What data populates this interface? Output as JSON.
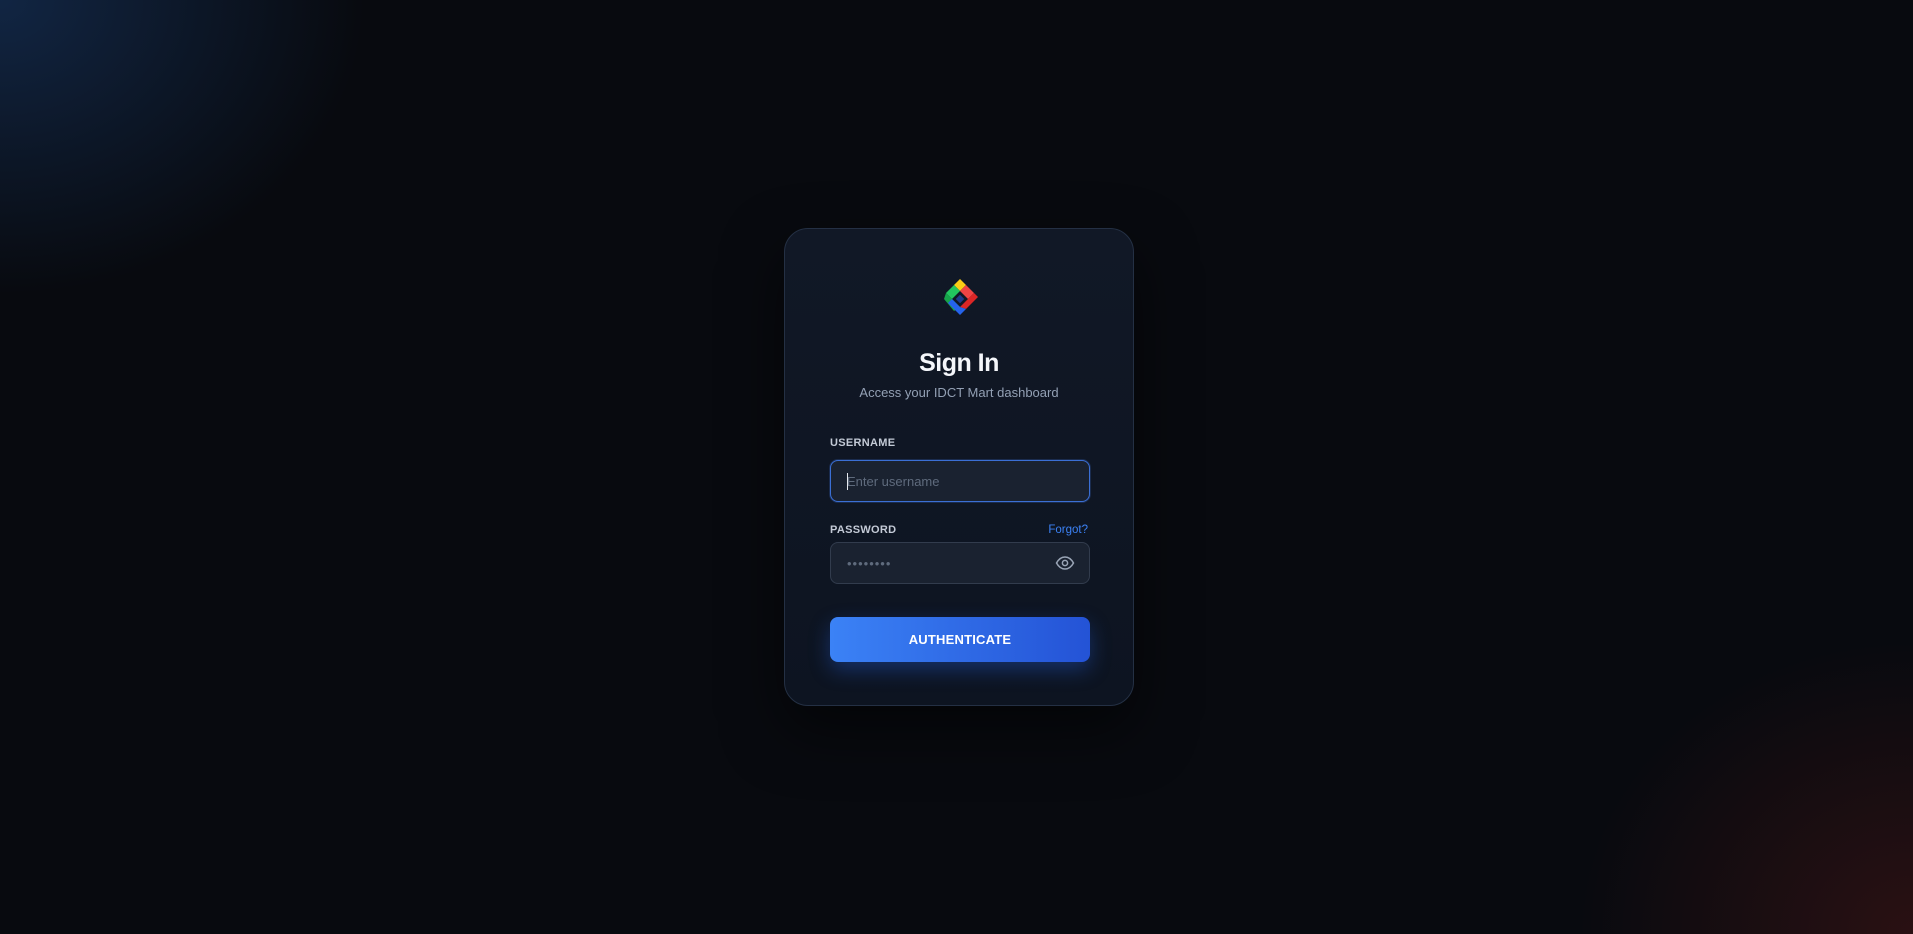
{
  "card": {
    "logo_icon": "idct-mart-diamond-logo",
    "title": "Sign In",
    "subtitle": "Access your IDCT Mart dashboard"
  },
  "username": {
    "label": "USERNAME",
    "placeholder": "Enter username",
    "value": ""
  },
  "password": {
    "label": "PASSWORD",
    "forgot_label": "Forgot?",
    "placeholder": "••••••••",
    "value": "",
    "toggle_icon": "eye-icon"
  },
  "submit": {
    "label": "AUTHENTICATE"
  },
  "colors": {
    "background": "#080a0f",
    "card": "#111826",
    "accent": "#3b82f6",
    "accent_dark": "#2453d6"
  }
}
